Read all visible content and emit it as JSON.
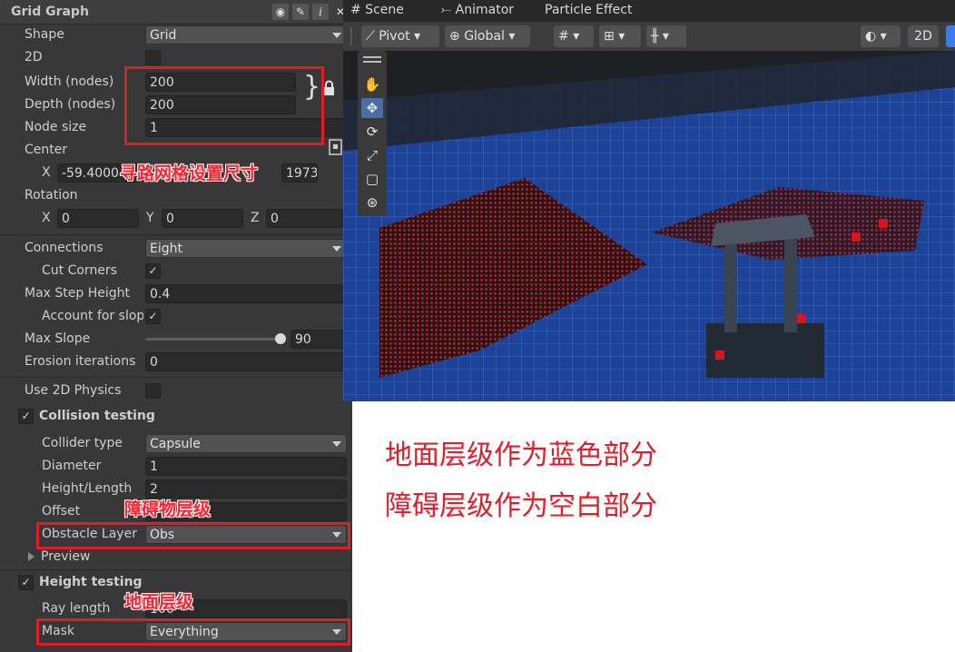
{
  "inspector": {
    "title": "Grid Graph",
    "header_icons": [
      "eye-icon",
      "pencil-icon",
      "info-icon",
      "close-icon"
    ],
    "shape": {
      "label": "Shape",
      "value": "Grid"
    },
    "two_d": {
      "label": "2D"
    },
    "width": {
      "label": "Width (nodes)",
      "value": "200"
    },
    "depth": {
      "label": "Depth (nodes)",
      "value": "200"
    },
    "brace": "}",
    "node_size": {
      "label": "Node size",
      "value": "1"
    },
    "center": {
      "label": "Center",
      "x_label": "X",
      "x_value": "-59.4000",
      "z_tail": "1973"
    },
    "rotation": {
      "label": "Rotation",
      "x_label": "X",
      "x_value": "0",
      "y_label": "Y",
      "y_value": "0",
      "z_label": "Z",
      "z_value": "0"
    },
    "connections": {
      "label": "Connections",
      "value": "Eight"
    },
    "cut_corners": {
      "label": "Cut Corners",
      "checked": "✓"
    },
    "max_step_height": {
      "label": "Max Step Height",
      "value": "0.4"
    },
    "account_for_slope": {
      "label": "Account for slop",
      "checked": "✓"
    },
    "max_slope": {
      "label": "Max Slope",
      "value": "90",
      "slider_fraction": 0.96
    },
    "erosion": {
      "label": "Erosion iterations",
      "value": "0"
    },
    "use_2d_physics": {
      "label": "Use 2D Physics"
    },
    "collision_testing": {
      "label": "Collision testing",
      "checked": "✓"
    },
    "collider_type": {
      "label": "Collider type",
      "value": "Capsule"
    },
    "diameter": {
      "label": "Diameter",
      "value": "1"
    },
    "height_length": {
      "label": "Height/Length",
      "value": "2"
    },
    "offset": {
      "label": "Offset"
    },
    "obstacle_layer": {
      "label": "Obstacle Layer",
      "value": "Obs"
    },
    "preview": {
      "label": "Preview"
    },
    "height_testing": {
      "label": "Height testing",
      "checked": "✓"
    },
    "ray_length": {
      "label": "Ray length",
      "value": "100"
    },
    "mask": {
      "label": "Mask",
      "value": "Everything"
    }
  },
  "annotations": {
    "grid_size": "寻路网格设置尺寸",
    "obstacle_layer": "障碍物层级",
    "ground_layer": "地面层级",
    "note_line1": "地面层级作为蓝色部分",
    "note_line2": "障碍层级作为空白部分"
  },
  "scene": {
    "tabs": [
      "# Scene",
      "Animator",
      "Particle Effect"
    ],
    "pivot": "Pivot",
    "global": "Global",
    "mode_2d": "2D",
    "tools": [
      "hand-tool-icon",
      "move-tool-icon",
      "rotate-tool-icon",
      "scale-tool-icon",
      "rect-tool-icon",
      "transform-tool-icon"
    ]
  },
  "colors": {
    "annotation_red": "#e11d2a",
    "panel_bg": "#383838",
    "ground_blue": "#1f3f8a",
    "obstacle_red": "#d8141e"
  }
}
